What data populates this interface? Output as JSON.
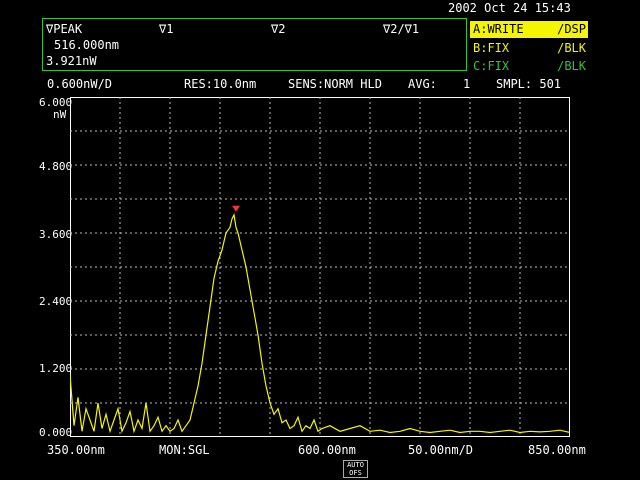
{
  "datetime": "2002 Oct 24 15:43",
  "marker_box": {
    "peak_label": "∇PEAK",
    "v1_label": "∇1",
    "v2_label": "∇2",
    "v2v1_label": "∇2/∇1",
    "wavelength": "516.000nm",
    "power": "3.921nW"
  },
  "traces": [
    {
      "name": "A:WRITE",
      "mode": "/DSP",
      "color": "#f5f500",
      "active": true
    },
    {
      "name": "B:FIX",
      "mode": "/BLK",
      "color": "#f5f500",
      "active": false
    },
    {
      "name": "C:FIX",
      "mode": "/BLK",
      "color": "#36c236",
      "active": false
    }
  ],
  "settings": {
    "scale": "0.600nW/D",
    "res": "RES:10.0nm",
    "sens": "SENS:NORM HLD",
    "avg_label": "AVG:",
    "avg_value": "1",
    "smpl": "SMPL: 501"
  },
  "y_axis": {
    "unit": "nW",
    "ticks": [
      "6.000",
      "4.800",
      "3.600",
      "2.400",
      "1.200",
      "0.000"
    ]
  },
  "bottom": {
    "start": "350.00nm",
    "monitor": "MON:SGL",
    "center": "600.00nm",
    "span_per_div": "50.00nm/D",
    "stop": "850.00nm"
  },
  "button": {
    "line1": "AUTO",
    "line2": "OFS"
  },
  "chart_data": {
    "type": "line",
    "x_unit": "nm",
    "y_unit": "nW",
    "xlim": [
      350,
      850
    ],
    "ylim": [
      0,
      6
    ],
    "grid": true,
    "trace_color": "#f5f500",
    "peak_marker": {
      "x": 516.0,
      "y": 3.921,
      "color": "#ff3030"
    },
    "series": [
      {
        "name": "A:WRITE",
        "x": [
          350,
          354,
          358,
          362,
          366,
          370,
          374,
          378,
          382,
          386,
          390,
          394,
          398,
          402,
          406,
          410,
          414,
          418,
          422,
          426,
          430,
          434,
          438,
          442,
          446,
          450,
          454,
          458,
          462,
          466,
          470,
          474,
          478,
          482,
          486,
          490,
          494,
          498,
          502,
          506,
          510,
          512,
          514,
          516,
          518,
          520,
          522,
          526,
          530,
          534,
          538,
          542,
          546,
          550,
          554,
          558,
          562,
          566,
          570,
          574,
          578,
          582,
          586,
          590,
          594,
          598,
          602,
          610,
          620,
          630,
          640,
          650,
          660,
          670,
          680,
          690,
          700,
          710,
          720,
          730,
          740,
          750,
          760,
          770,
          780,
          790,
          800,
          810,
          820,
          830,
          840,
          850
        ],
        "y": [
          1.1,
          0.2,
          0.7,
          0.1,
          0.5,
          0.3,
          0.1,
          0.6,
          0.15,
          0.4,
          0.1,
          0.3,
          0.5,
          0.1,
          0.25,
          0.45,
          0.1,
          0.3,
          0.15,
          0.6,
          0.1,
          0.2,
          0.35,
          0.1,
          0.2,
          0.1,
          0.15,
          0.3,
          0.1,
          0.2,
          0.3,
          0.6,
          0.9,
          1.3,
          1.8,
          2.3,
          2.8,
          3.1,
          3.3,
          3.6,
          3.7,
          3.85,
          3.921,
          3.7,
          3.6,
          3.45,
          3.3,
          3.0,
          2.6,
          2.2,
          1.8,
          1.3,
          0.9,
          0.6,
          0.4,
          0.5,
          0.25,
          0.3,
          0.15,
          0.2,
          0.35,
          0.1,
          0.2,
          0.15,
          0.3,
          0.1,
          0.15,
          0.2,
          0.1,
          0.15,
          0.2,
          0.1,
          0.12,
          0.08,
          0.1,
          0.15,
          0.1,
          0.08,
          0.1,
          0.12,
          0.08,
          0.1,
          0.1,
          0.08,
          0.1,
          0.12,
          0.08,
          0.1,
          0.09,
          0.1,
          0.12,
          0.08
        ]
      }
    ]
  }
}
